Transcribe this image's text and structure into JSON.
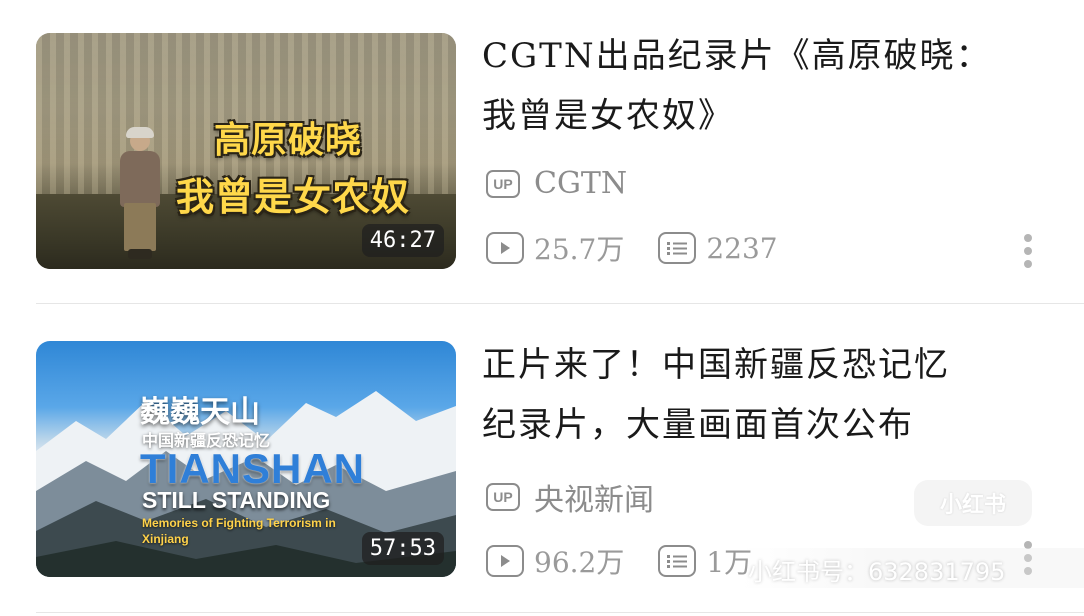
{
  "videos": [
    {
      "cover_text": [
        "高原破晓",
        "我曾是女农奴"
      ],
      "duration": "46:27",
      "title_lines": [
        "CGTN出品纪录片《高原破晓：",
        "我曾是女农奴》"
      ],
      "uploader_badge": "UP",
      "uploader": "CGTN",
      "views": "25.7万",
      "danmaku": "2237"
    },
    {
      "cover_text": {
        "cn_big": "巍巍天山",
        "cn_small": "中国新疆反恐记忆",
        "en_big": "TIANSHAN",
        "en_mid": "STILL STANDING",
        "en_small": "Memories of Fighting Terrorism in Xinjiang"
      },
      "duration": "57:53",
      "title_lines": [
        "正片来了！中国新疆反恐记忆",
        "纪录片，大量画面首次公布"
      ],
      "uploader_badge": "UP",
      "uploader": "央视新闻",
      "views": "96.2万",
      "danmaku": "1万"
    }
  ],
  "icons": {
    "play": "play-count-icon",
    "danmaku": "danmaku-icon",
    "more": "more-vertical-icon"
  },
  "watermark": {
    "logo": "小红书",
    "text": "小红书号：632831795"
  },
  "colors": {
    "meta_gray": "#8c8c8c",
    "cover_yellow": "#ffd84a",
    "title_blue": "#2f7fd8"
  }
}
